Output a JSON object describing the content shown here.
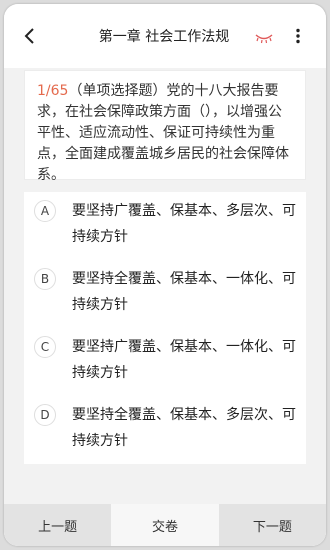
{
  "header": {
    "title": "第一章 社会工作法规",
    "back_icon": "chevron-left-icon",
    "eye_icon": "eye-closed-icon",
    "more_icon": "more-vertical-icon",
    "accent_color": "#e05a5a"
  },
  "question": {
    "index": "1/65",
    "text": "（单项选择题）党的十八大报告要求，在社会保障政策方面（），以增强公平性、适应流动性、保证可持续性为重点，全面建成覆盖城乡居民的社会保障体系。",
    "index_color": "#e46a4d"
  },
  "options": [
    {
      "letter": "A",
      "text": "要坚持广覆盖、保基本、多层次、可持续方针"
    },
    {
      "letter": "B",
      "text": "要坚持全覆盖、保基本、一体化、可持续方针"
    },
    {
      "letter": "C",
      "text": "要坚持广覆盖、保基本、一体化、可持续方针"
    },
    {
      "letter": "D",
      "text": "要坚持全覆盖、保基本、多层次、可持续方针"
    }
  ],
  "bottom_bar": {
    "prev_label": "上一题",
    "submit_label": "交卷",
    "next_label": "下一题"
  }
}
